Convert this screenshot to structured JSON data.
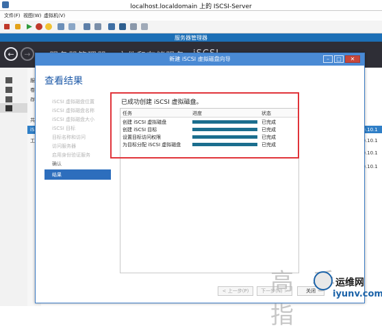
{
  "vm": {
    "title": "localhost.localdomain 上的 ISCSI-Server",
    "menu": [
      "文件(F)",
      "视图(W)",
      "虚拟机(V)"
    ]
  },
  "server_manager": {
    "title": "服务器管理器",
    "breadcrumb": [
      "服务器管理器",
      "文件和存储服务",
      "iSCSI"
    ],
    "left_fragments": [
      "服",
      "卷",
      "存",
      "共",
      "iS",
      "工"
    ],
    "right_ips": [
      "10.10.1",
      "10.10.1",
      "10.10.1",
      "10.10.1"
    ]
  },
  "wizard": {
    "title": "新建 iSCSI 虚拟磁盘向导",
    "heading": "查看结果",
    "steps": [
      {
        "label": "iSCSI 虚拟磁盘位置",
        "done": false
      },
      {
        "label": "iSCSI 虚拟磁盘名称",
        "done": false
      },
      {
        "label": "iSCSI 虚拟磁盘大小",
        "done": false
      },
      {
        "label": "iSCSI 目标",
        "done": false
      },
      {
        "label": "目标名称和访问",
        "done": false
      },
      {
        "label": "访问服务器",
        "done": false
      },
      {
        "label": "启用身份验证服务",
        "done": false
      },
      {
        "label": "确认",
        "done": true
      },
      {
        "label": "结果",
        "done": true
      }
    ],
    "selected_step": "结果",
    "success_message": "已成功创建 iSCSI 虚拟磁盘。",
    "columns": [
      "任务",
      "进度",
      "状态"
    ],
    "tasks": [
      {
        "name": "创建 iSCSI 虚拟磁盘",
        "progress": 1.0,
        "status": "已完成"
      },
      {
        "name": "创建 iSCSI 目标",
        "progress": 1.0,
        "status": "已完成"
      },
      {
        "name": "设置目标访问权限",
        "progress": 1.0,
        "status": "已完成"
      },
      {
        "name": "为目标分配 iSCSI 虚拟磁盘",
        "progress": 1.0,
        "status": "已完成"
      }
    ],
    "buttons": {
      "prev": "< 上一步(P)",
      "next": "下一步(N) >",
      "close": "关闭"
    }
  },
  "watermark": {
    "text": "高 手 指",
    "site_name": "运维网",
    "url": "iyunv.com"
  }
}
